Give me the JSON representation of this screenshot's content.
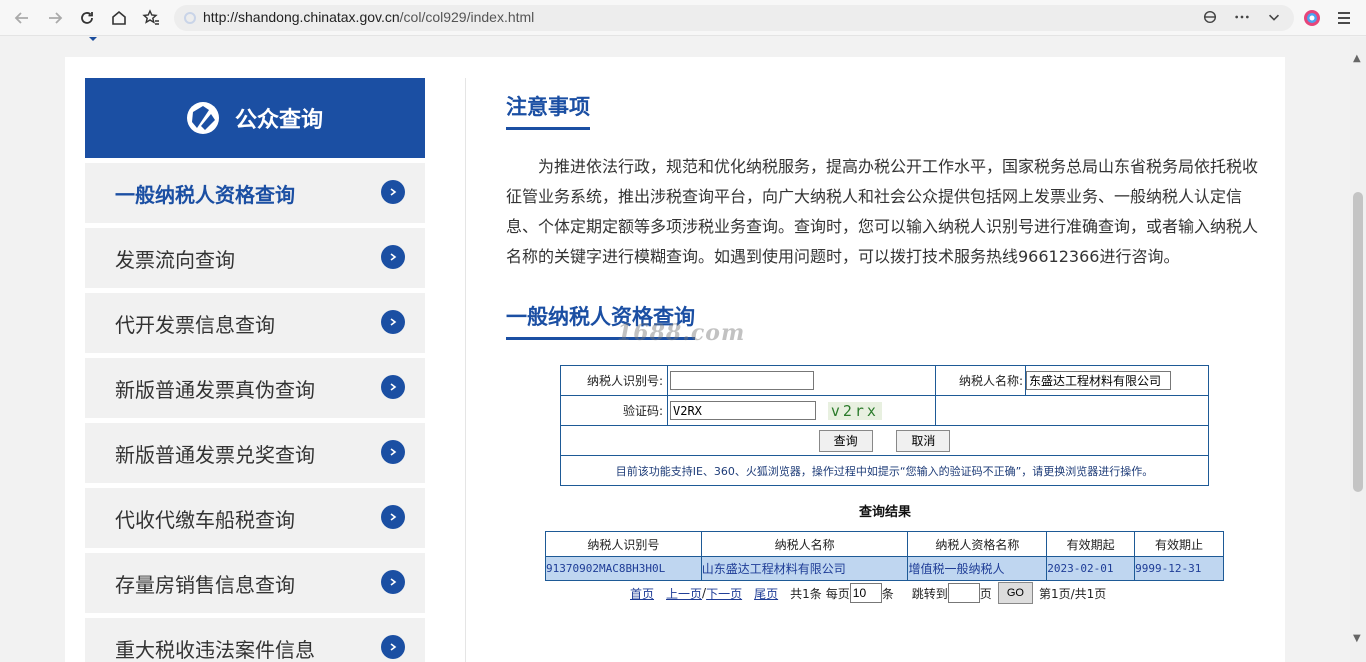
{
  "browser": {
    "url_host": "http://shandong.chinatax.gov.cn",
    "url_path": "/col/col929/index.html"
  },
  "sidebar": {
    "header": "公众查询",
    "items": [
      {
        "label": "一般纳税人资格查询",
        "active": true
      },
      {
        "label": "发票流向查询"
      },
      {
        "label": "代开发票信息查询"
      },
      {
        "label": "新版普通发票真伪查询"
      },
      {
        "label": "新版普通发票兑奖查询"
      },
      {
        "label": "代收代缴车船税查询"
      },
      {
        "label": "存量房销售信息查询"
      },
      {
        "label": "重大税收违法案件信息"
      }
    ]
  },
  "notice": {
    "title": "注意事项",
    "text": "为推进依法行政，规范和优化纳税服务，提高办税公开工作水平，国家税务总局山东省税务局依托税收征管业务系统，推出涉税查询平台，向广大纳税人和社会公众提供包括网上发票业务、一般纳税人认定信息、个体定期定额等多项涉税业务查询。查询时，您可以输入纳税人识别号进行准确查询，或者输入纳税人名称的关键字进行模糊查询。如遇到使用问题时，可以拨打技术服务热线96612366进行咨询。"
  },
  "query": {
    "title": "一般纳税人资格查询",
    "watermark": "1688.com",
    "taxid_label": "纳税人识别号:",
    "taxid_value": "",
    "name_label": "纳税人名称:",
    "name_value": "东盛达工程材料有限公司",
    "captcha_label": "验证码:",
    "captcha_value": "V2RX",
    "captcha_image_text": "v2rx",
    "search_button": "查询",
    "cancel_button": "取消",
    "hint": "目前该功能支持IE、360、火狐浏览器，操作过程中如提示“您输入的验证码不正确”，请更换浏览器进行操作。"
  },
  "results": {
    "title": "查询结果",
    "columns": [
      "纳税人识别号",
      "纳税人名称",
      "纳税人资格名称",
      "有效期起",
      "有效期止"
    ],
    "rows": [
      [
        "91370902MAC8BH3H0L",
        "山东盛达工程材料有限公司",
        "增值税一般纳税人",
        "2023-02-01",
        "9999-12-31"
      ]
    ]
  },
  "pager": {
    "first": "首页",
    "prev": "上一页",
    "sep": "/",
    "next": "下一页",
    "last": "尾页",
    "total": "共1条",
    "per_page_label": "每页",
    "per_page_value": "10",
    "per_page_unit": "条",
    "jump_label": "跳转到",
    "jump_value": "",
    "jump_unit": "页",
    "go": "GO",
    "status": "第1页/共1页"
  },
  "colors": {
    "brand": "#1b4fa3",
    "table_border": "#1e5a96",
    "row_bg": "#bfd6f0"
  }
}
